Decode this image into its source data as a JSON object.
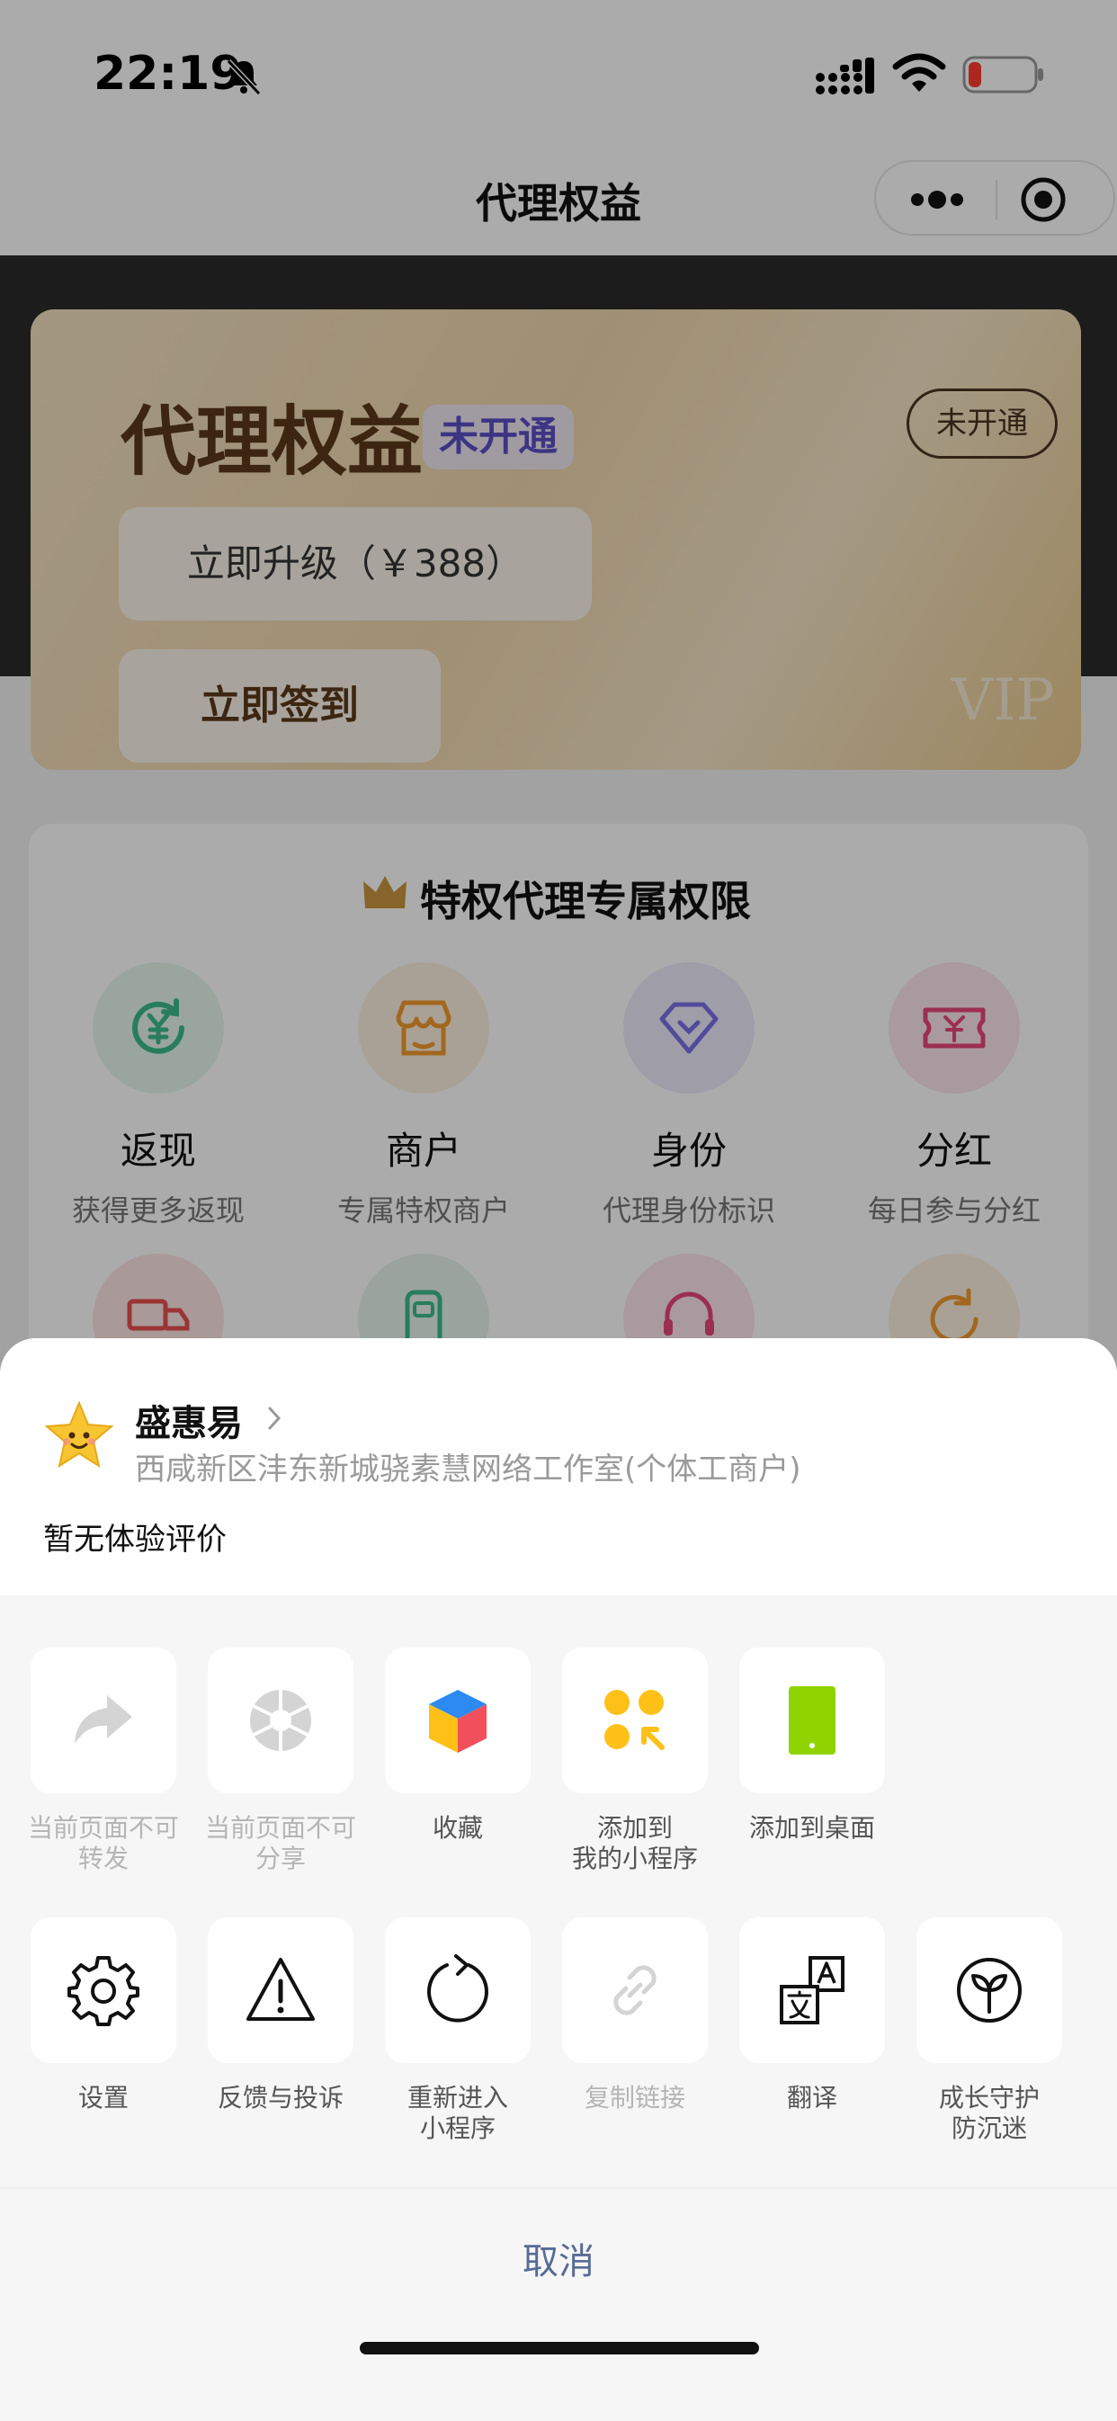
{
  "status_bar": {
    "time": "22:19"
  },
  "nav": {
    "title": "代理权益"
  },
  "vip_card": {
    "title": "代理权益",
    "badge": "未开通",
    "status": "未开通",
    "upgrade_label": "立即升级（￥388）",
    "checkin_label": "立即签到",
    "watermark": "VIP"
  },
  "privileges": {
    "title": "特权代理专属权限",
    "items": [
      {
        "name": "返现",
        "desc": "获得更多返现",
        "icon": "yuan-refresh-icon",
        "color": "#3dbb8a"
      },
      {
        "name": "商户",
        "desc": "专属特权商户",
        "icon": "store-icon",
        "color": "#f29a2e"
      },
      {
        "name": "身份",
        "desc": "代理身份标识",
        "icon": "diamond-icon",
        "color": "#7b6fe6"
      },
      {
        "name": "分红",
        "desc": "每日参与分红",
        "icon": "ticket-icon",
        "color": "#e8477a"
      }
    ]
  },
  "sheet": {
    "app_name": "盛惠易",
    "company": "西咸新区沣东新城骁素慧网络工作室(个体工商户)",
    "review": "暂无体验评价",
    "row1": [
      {
        "label": "当前页面不可\n转发",
        "icon": "forward-icon",
        "enabled": false
      },
      {
        "label": "当前页面不可\n分享",
        "icon": "aperture-icon",
        "enabled": false
      },
      {
        "label": "收藏",
        "icon": "favorite-cube-icon",
        "enabled": true
      },
      {
        "label": "添加到\n我的小程序",
        "icon": "add-miniprogram-icon",
        "enabled": true
      },
      {
        "label": "添加到桌面",
        "icon": "add-desktop-icon",
        "enabled": true
      }
    ],
    "row2": [
      {
        "label": "设置",
        "icon": "gear-icon",
        "enabled": true
      },
      {
        "label": "反馈与投诉",
        "icon": "warning-icon",
        "enabled": true
      },
      {
        "label": "重新进入\n小程序",
        "icon": "reload-icon",
        "enabled": true
      },
      {
        "label": "复制链接",
        "icon": "link-icon",
        "enabled": false
      },
      {
        "label": "翻译",
        "icon": "translate-icon",
        "enabled": true
      },
      {
        "label": "成长守护\n防沉迷",
        "icon": "sprout-icon",
        "enabled": true
      }
    ],
    "cancel": "取消"
  }
}
